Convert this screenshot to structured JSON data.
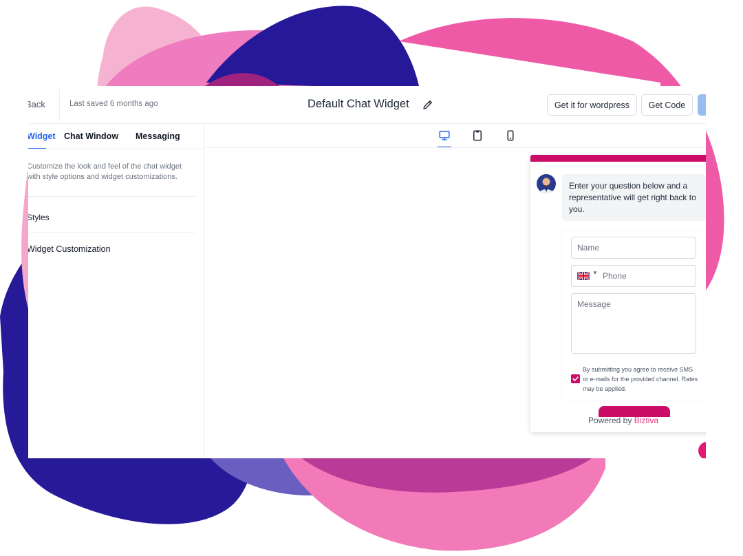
{
  "header": {
    "back_label": "Back",
    "saved_text": "Last saved 6 months ago",
    "title": "Default Chat Widget",
    "wordpress_button": "Get it for wordpress",
    "code_button": "Get Code"
  },
  "sidebar": {
    "tabs": [
      "Widget",
      "Chat Window",
      "Messaging"
    ],
    "active_tab": "Widget",
    "description": "Customize the look and feel of the chat widget with style options and widget customizations.",
    "sections": [
      "Styles",
      "Widget Customization"
    ]
  },
  "preview": {
    "devices": [
      "desktop-icon",
      "tablet-icon",
      "mobile-icon"
    ],
    "active_device": "desktop"
  },
  "chat": {
    "greeting": "Enter your question below and a representative will get right back to you.",
    "name_placeholder": "Name",
    "phone_placeholder": "Phone",
    "message_placeholder": "Message",
    "consent_text": "By submitting you agree to receive SMS or e-mails for the provided channel. Rates may be applied.",
    "consent_checked": true,
    "powered_by": "Powered by",
    "brand": "Biztiva",
    "accent_color": "#cc0d68"
  },
  "colors": {
    "primary_blue": "#2563eb",
    "blob_pink": "#ee5aa6",
    "blob_navy": "#271a9a"
  }
}
